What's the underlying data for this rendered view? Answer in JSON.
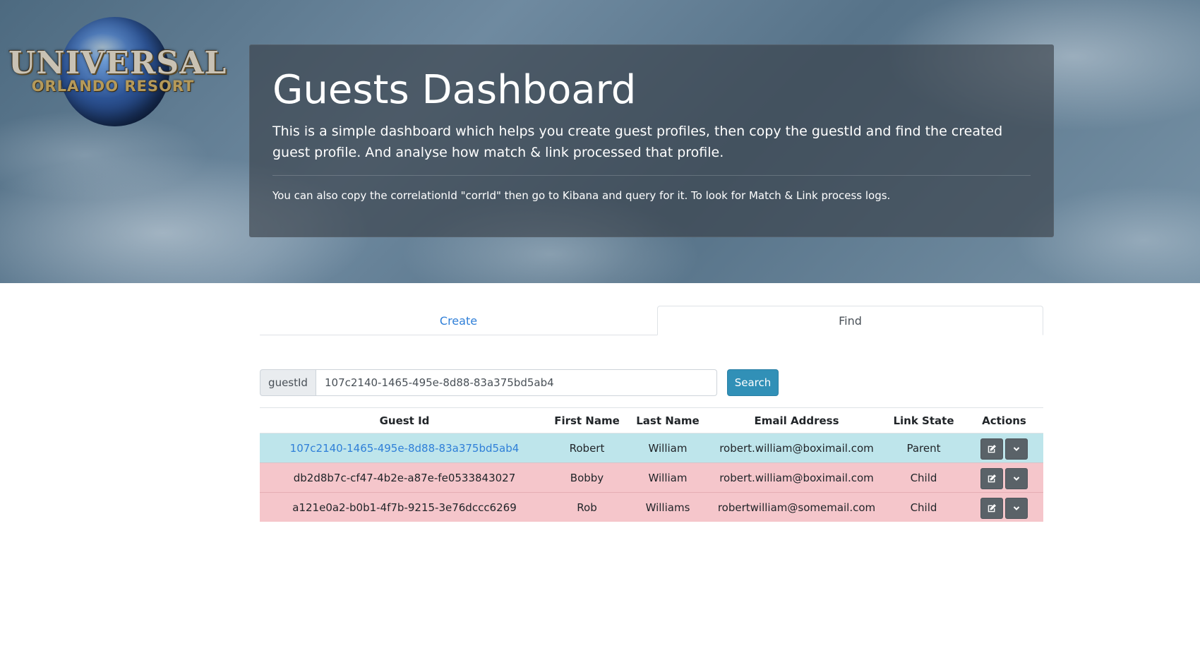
{
  "brand": {
    "logo_main": "UNIVERSAL",
    "logo_sub": "ORLANDO RESORT"
  },
  "hero": {
    "title": "Guests Dashboard",
    "lead": "This is a simple dashboard which helps you create guest profiles, then copy the guestId and find the created guest profile. And analyse how match & link processed that profile.",
    "note": "You can also copy the correlationId \"corrId\" then go to Kibana and query for it. To look for Match & Link process logs."
  },
  "tabs": [
    {
      "label": "Create",
      "active": false
    },
    {
      "label": "Find",
      "active": true
    }
  ],
  "search": {
    "prefix": "guestId",
    "value": "107c2140-1465-495e-8d88-83a375bd5ab4",
    "button_label": "Search"
  },
  "table": {
    "headers": [
      "Guest Id",
      "First Name",
      "Last Name",
      "Email Address",
      "Link State",
      "Actions"
    ],
    "rows": [
      {
        "guest_id": "107c2140-1465-495e-8d88-83a375bd5ab4",
        "first_name": "Robert",
        "last_name": "William",
        "email": "robert.william@boximail.com",
        "link_state": "Parent"
      },
      {
        "guest_id": "db2d8b7c-cf47-4b2e-a87e-fe0533843027",
        "first_name": "Bobby",
        "last_name": "William",
        "email": "robert.william@boximail.com",
        "link_state": "Child"
      },
      {
        "guest_id": "a121e0a2-b0b1-4f7b-9215-3e76dccc6269",
        "first_name": "Rob",
        "last_name": "Williams",
        "email": "robertwilliam@somemail.com",
        "link_state": "Child"
      }
    ]
  },
  "colors": {
    "parent_row": "#bee5eb",
    "child_row": "#f5c6cb",
    "link": "#2f7fd8",
    "search_button": "#3190b7",
    "action_button": "#5a6268"
  },
  "icons": {
    "edit": "edit-icon",
    "expand": "chevron-down-icon"
  }
}
